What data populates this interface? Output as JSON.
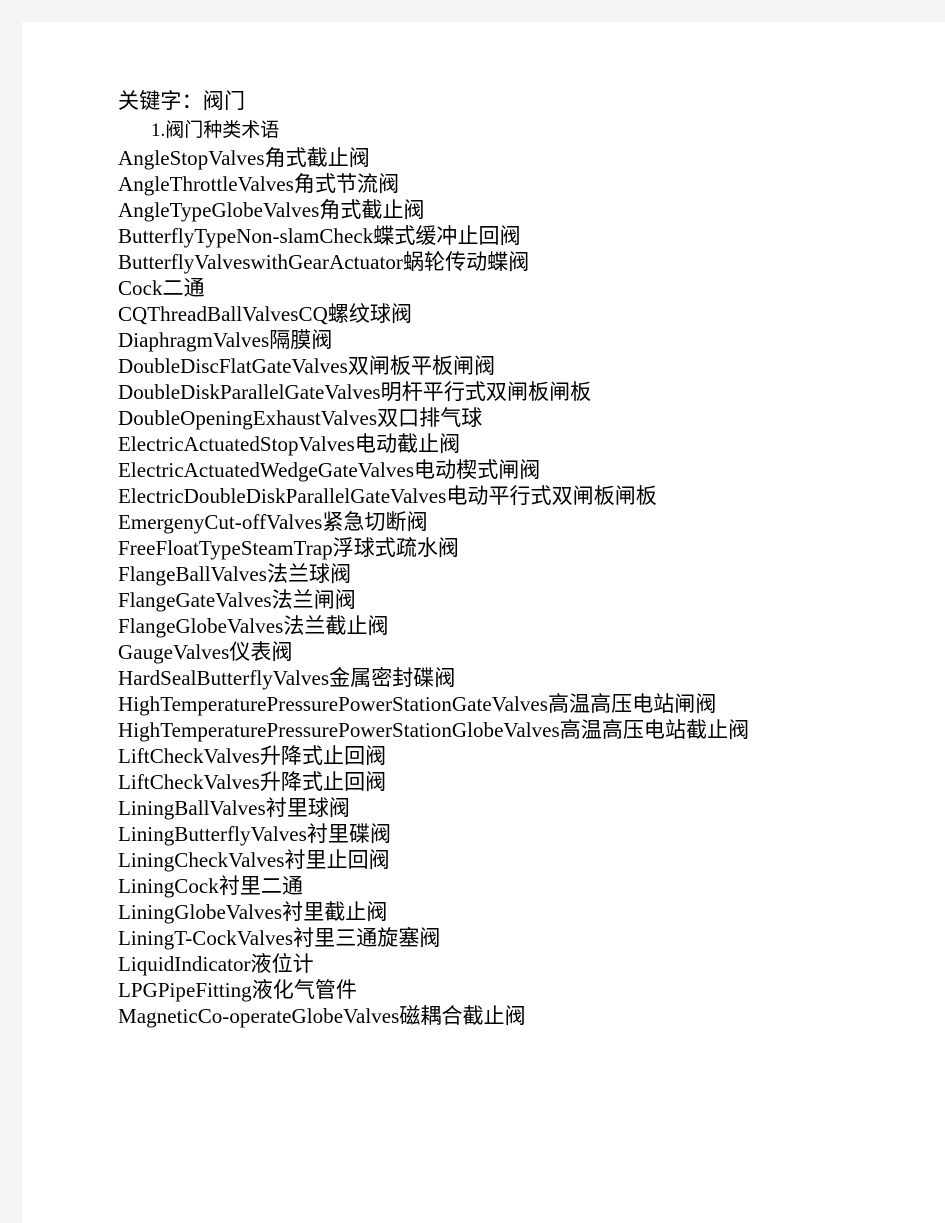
{
  "document": {
    "keywords_line": "关键字：阀门",
    "section_heading": "1.阀门种类术语",
    "terms": [
      {
        "en": "AngleStopValves",
        "zh": "角式截止阀"
      },
      {
        "en": "AngleThrottleValves",
        "zh": "角式节流阀"
      },
      {
        "en": "AngleTypeGlobeValves",
        "zh": "角式截止阀"
      },
      {
        "en": "ButterflyTypeNon-slamCheck",
        "zh": "蝶式缓冲止回阀"
      },
      {
        "en": "ButterflyValveswithGearActuator",
        "zh": "蜗轮传动蝶阀"
      },
      {
        "en": "Cock",
        "zh": "二通"
      },
      {
        "en": "CQThreadBallValvesCQ",
        "zh": "螺纹球阀"
      },
      {
        "en": "DiaphragmValves",
        "zh": "隔膜阀"
      },
      {
        "en": "DoubleDiscFlatGateValves",
        "zh": "双闸板平板闸阀"
      },
      {
        "en": "DoubleDiskParallelGateValves",
        "zh": "明杆平行式双闸板闸板"
      },
      {
        "en": "DoubleOpeningExhaustValves",
        "zh": "双口排气球"
      },
      {
        "en": "ElectricActuatedStopValves",
        "zh": "电动截止阀"
      },
      {
        "en": "ElectricActuatedWedgeGateValves",
        "zh": "电动楔式闸阀"
      },
      {
        "en": "ElectricDoubleDiskParallelGateValves",
        "zh": "电动平行式双闸板闸板"
      },
      {
        "en": "EmergenyCut-offValves",
        "zh": "紧急切断阀"
      },
      {
        "en": "FreeFloatTypeSteamTrap",
        "zh": "浮球式疏水阀"
      },
      {
        "en": "FlangeBallValves",
        "zh": "法兰球阀"
      },
      {
        "en": "FlangeGateValves",
        "zh": "法兰闸阀"
      },
      {
        "en": "FlangeGlobeValves",
        "zh": "法兰截止阀"
      },
      {
        "en": "GaugeValves",
        "zh": "仪表阀"
      },
      {
        "en": "HardSealButterflyValves",
        "zh": "金属密封碟阀"
      },
      {
        "en": "HighTemperaturePressurePowerStationGateValves",
        "zh": "高温高压电站闸阀"
      },
      {
        "en": "HighTemperaturePressurePowerStationGlobeValves",
        "zh": "高温高压电站截止阀"
      },
      {
        "en": "LiftCheckValves",
        "zh": "升降式止回阀"
      },
      {
        "en": "LiftCheckValves",
        "zh": "升降式止回阀"
      },
      {
        "en": "LiningBallValves",
        "zh": "衬里球阀"
      },
      {
        "en": "LiningButterflyValves",
        "zh": "衬里碟阀"
      },
      {
        "en": "LiningCheckValves",
        "zh": "衬里止回阀"
      },
      {
        "en": "LiningCock",
        "zh": "衬里二通"
      },
      {
        "en": "LiningGlobeValves",
        "zh": "衬里截止阀"
      },
      {
        "en": "LiningT-CockValves",
        "zh": "衬里三通旋塞阀"
      },
      {
        "en": "LiquidIndicator",
        "zh": "液位计"
      },
      {
        "en": "LPGPipeFitting",
        "zh": "液化气管件"
      },
      {
        "en": "MagneticCo-operateGlobeValves",
        "zh": "磁耦合截止阀"
      }
    ]
  },
  "colors": {
    "page_background": "#ffffff",
    "canvas_background": "#f4f4f4",
    "text": "#000000"
  }
}
